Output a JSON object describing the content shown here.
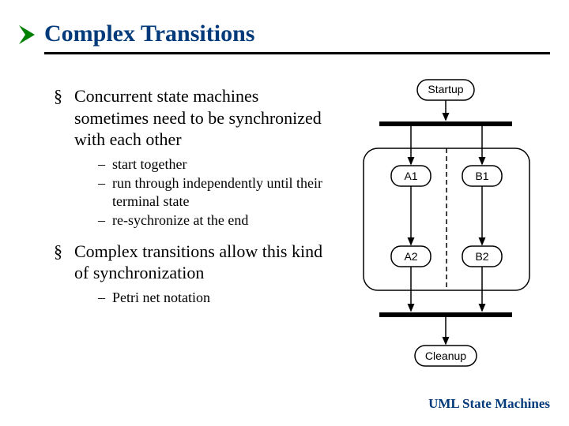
{
  "title": "Complex Transitions",
  "bullets": {
    "p1": "Concurrent state machines sometimes need to be synchronized with each other",
    "sub1a": "start together",
    "sub1b": "run through independently until their terminal state",
    "sub1c": "re-sychronize at the end",
    "p2": "Complex transitions allow this kind of synchronization",
    "sub2a": "Petri net notation"
  },
  "footer": "UML State Machines",
  "diagram": {
    "startup": "Startup",
    "a1": "A1",
    "a2": "A2",
    "b1": "B1",
    "b2": "B2",
    "cleanup": "Cleanup"
  }
}
